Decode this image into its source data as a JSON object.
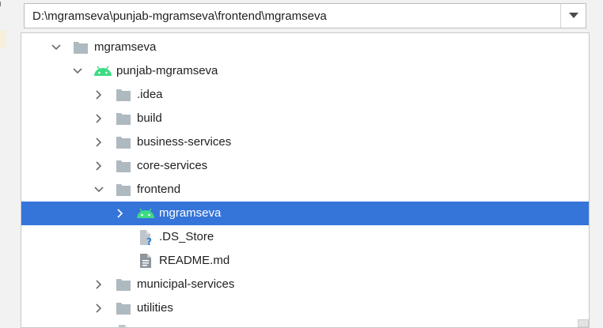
{
  "path_field": {
    "value": "D:\\mgramseva\\punjab-mgramseva\\frontend\\mgramseva"
  },
  "tree": {
    "rows": [
      {
        "label": "mgramseva"
      },
      {
        "label": "punjab-mgramseva"
      },
      {
        "label": ".idea"
      },
      {
        "label": "build"
      },
      {
        "label": "business-services"
      },
      {
        "label": "core-services"
      },
      {
        "label": "frontend"
      },
      {
        "label": "mgramseva"
      },
      {
        "label": ".DS_Store"
      },
      {
        "label": "README.md"
      },
      {
        "label": "municipal-services"
      },
      {
        "label": "utilities"
      },
      {
        "label": ".DS_Store"
      }
    ]
  },
  "colors": {
    "selection": "#3574d9",
    "folder": "#aeb9c0",
    "android": "#3ddc84",
    "unknown_file_badge": "#2f7fd8"
  }
}
